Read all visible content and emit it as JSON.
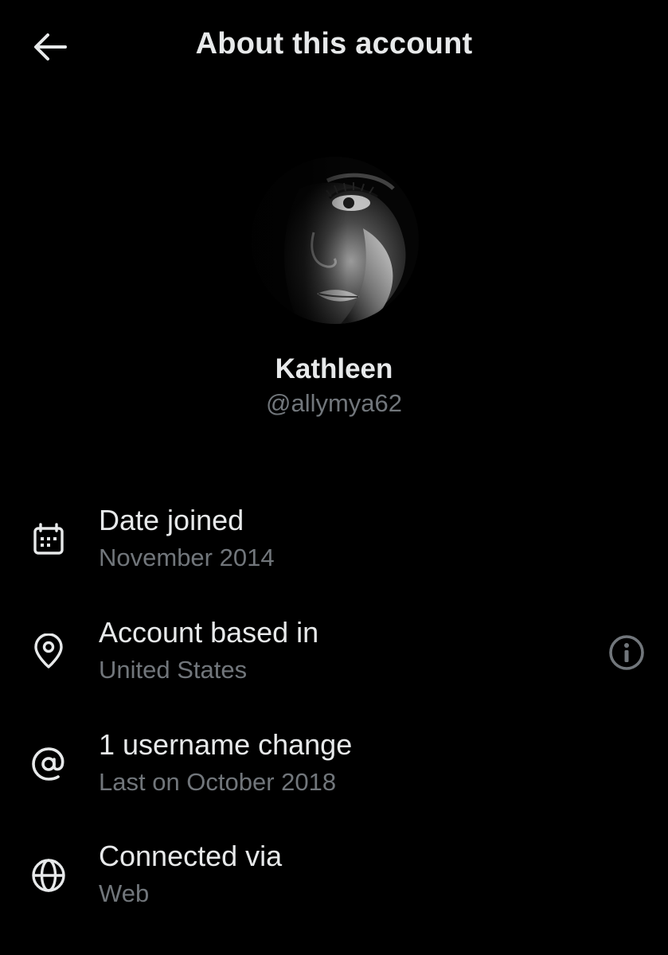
{
  "header": {
    "title": "About this account",
    "back_icon": "arrow-left-icon"
  },
  "profile": {
    "display_name": "Kathleen",
    "handle": "@allymya62",
    "avatar": "profile-photo-grayscale-face"
  },
  "rows": [
    {
      "icon": "calendar-icon",
      "title": "Date joined",
      "subtitle": "November 2014"
    },
    {
      "icon": "location-pin-icon",
      "title": "Account based in",
      "subtitle": "United States",
      "action_icon": "info-icon"
    },
    {
      "icon": "at-sign-icon",
      "title": "1 username change",
      "subtitle": "Last on October 2018"
    },
    {
      "icon": "globe-icon",
      "title": "Connected via",
      "subtitle": "Web"
    }
  ],
  "colors": {
    "background": "#000000",
    "primary_text": "#e7e9ea",
    "secondary_text": "#71767b"
  }
}
